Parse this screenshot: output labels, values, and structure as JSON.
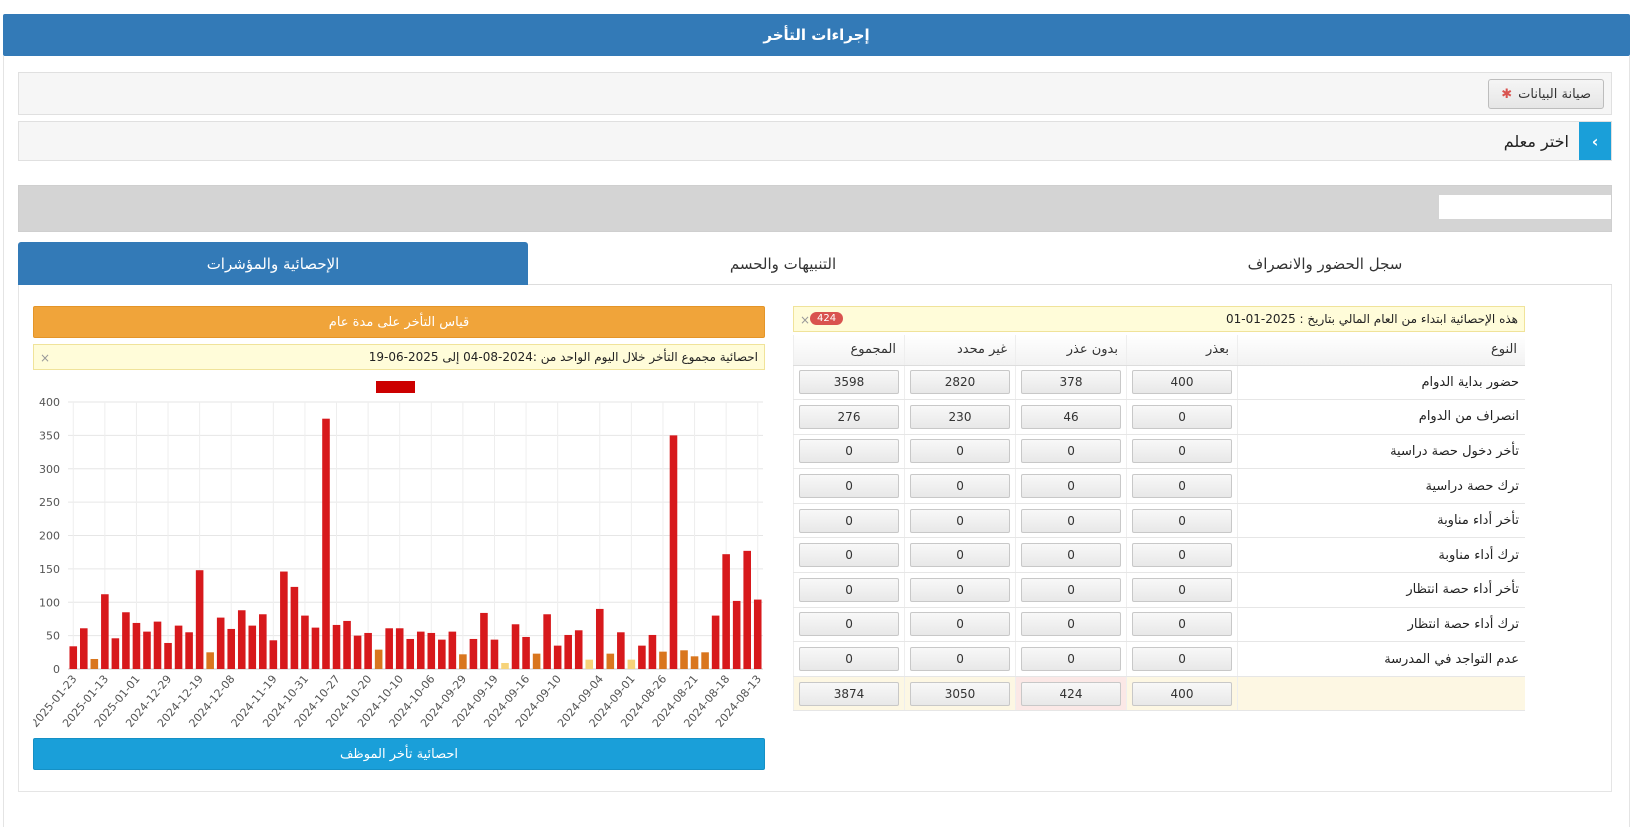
{
  "header": {
    "title": "إجراءات التأخر"
  },
  "toolbar": {
    "maintenance_label": "صيانة البيانات",
    "maintenance_icon": "gear-icon"
  },
  "teacher": {
    "label": "اختر معلم",
    "toggle_icon": "chevron-left-icon"
  },
  "tabs": [
    {
      "label": "سجل الحضور والانصراف",
      "active": false
    },
    {
      "label": "التنبيهات والحسم",
      "active": false
    },
    {
      "label": "الإحصائية والمؤشرات",
      "active": true
    }
  ],
  "left_panel": {
    "top_button": "قياس التأخر على مدة عام",
    "alert_text": "احصائية مجموع التأخر خلال اليوم الواحد من :2024-08-04 إلى 2025-06-19",
    "bottom_button": "احصائية تأخر الموظف",
    "close_symbol": "×"
  },
  "right_panel": {
    "alert_text": "هذه الإحصائية ابتداء من العام المالي بتاريخ : 2025-01-01",
    "badge": "424",
    "close_symbol": "×",
    "columns": [
      "النوع",
      "بعذر",
      "بدون عذر",
      "غير محدد",
      "المجموع"
    ],
    "rows": [
      {
        "label": "حضور بداية الدوام",
        "values": [
          "400",
          "378",
          "2820",
          "3598"
        ]
      },
      {
        "label": "انصراف من الدوام",
        "values": [
          "0",
          "46",
          "230",
          "276"
        ]
      },
      {
        "label": "تأخر دخول حصة دراسية",
        "values": [
          "0",
          "0",
          "0",
          "0"
        ]
      },
      {
        "label": "ترك حصة دراسية",
        "values": [
          "0",
          "0",
          "0",
          "0"
        ]
      },
      {
        "label": "تأخر أداء مناوبة",
        "values": [
          "0",
          "0",
          "0",
          "0"
        ]
      },
      {
        "label": "ترك أداء مناوبة",
        "values": [
          "0",
          "0",
          "0",
          "0"
        ]
      },
      {
        "label": "تأخر أداء حصة انتظار",
        "values": [
          "0",
          "0",
          "0",
          "0"
        ]
      },
      {
        "label": "ترك أداء حصة انتظار",
        "values": [
          "0",
          "0",
          "0",
          "0"
        ]
      },
      {
        "label": "عدم التواجد في المدرسة",
        "values": [
          "0",
          "0",
          "0",
          "0"
        ]
      }
    ],
    "totals": [
      "400",
      "424",
      "3050",
      "3874"
    ]
  },
  "chart_data": {
    "type": "bar",
    "ylim": [
      0,
      400
    ],
    "yticks": [
      0,
      50,
      100,
      150,
      200,
      250,
      300,
      350,
      400
    ],
    "xtick_labels": [
      "2025-01-23",
      "2025-01-13",
      "2025-01-01",
      "2024-12-29",
      "2024-12-19",
      "2024-12-08",
      "2024-11-19",
      "2024-10-31",
      "2024-10-27",
      "2024-10-20",
      "2024-10-10",
      "2024-10-06",
      "2024-09-29",
      "2024-09-19",
      "2024-09-16",
      "2024-09-10",
      "2024-09-04",
      "2024-09-01",
      "2024-08-26",
      "2024-08-21",
      "2024-08-18",
      "2024-08-13"
    ],
    "values": [
      34,
      61,
      15,
      112,
      46,
      85,
      69,
      56,
      71,
      39,
      65,
      55,
      148,
      25,
      77,
      60,
      88,
      65,
      82,
      43,
      146,
      123,
      80,
      62,
      375,
      66,
      72,
      50,
      54,
      29,
      61,
      61,
      45,
      56,
      54,
      44,
      56,
      22,
      45,
      84,
      44,
      9,
      67,
      48,
      23,
      82,
      35,
      51,
      58,
      14,
      90,
      23,
      55,
      14,
      35,
      51,
      26,
      350,
      28,
      19,
      25,
      80,
      172,
      102,
      177,
      104
    ],
    "color_levels": [
      "red",
      "red",
      "orange",
      "red",
      "red",
      "red",
      "red",
      "red",
      "red",
      "red",
      "red",
      "red",
      "red",
      "orange",
      "red",
      "red",
      "red",
      "red",
      "red",
      "red",
      "red",
      "red",
      "red",
      "red",
      "red",
      "red",
      "red",
      "red",
      "red",
      "orange",
      "red",
      "red",
      "red",
      "red",
      "red",
      "red",
      "red",
      "orange",
      "red",
      "red",
      "red",
      "yellow",
      "red",
      "red",
      "orange",
      "red",
      "red",
      "red",
      "red",
      "yellow",
      "red",
      "orange",
      "red",
      "yellow",
      "red",
      "red",
      "orange",
      "red",
      "orange",
      "orange",
      "orange",
      "red",
      "red",
      "red",
      "red",
      "red"
    ],
    "colors": {
      "red": "#d7191c",
      "orange": "#d9761e",
      "yellow": "#f6d37a",
      "legend": "#cc0000"
    }
  }
}
